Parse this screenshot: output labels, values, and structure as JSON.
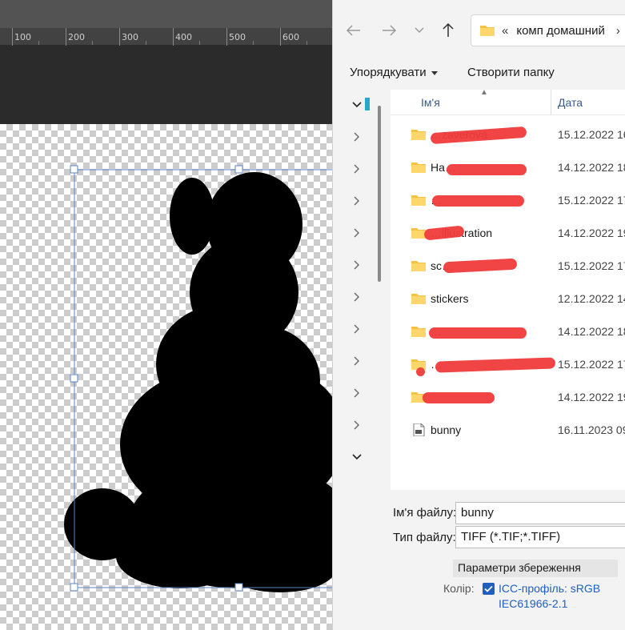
{
  "ruler": {
    "labels": [
      "100",
      "200",
      "300",
      "400",
      "500",
      "600"
    ]
  },
  "dialog": {
    "address": {
      "separator": "«",
      "path": "комп домашний",
      "arrow": "›"
    },
    "commands": {
      "organize": "Упорядкувати",
      "new_folder": "Створити папку"
    },
    "columns": {
      "name": "Ім'я",
      "date": "Дата"
    },
    "files": [
      {
        "name": "…zaverova",
        "date": "15.12.2022 16",
        "type": "folder"
      },
      {
        "name": "Ha…",
        "date": "14.12.2022 18",
        "type": "folder"
      },
      {
        "name": "…",
        "date": "15.12.2022 17",
        "type": "folder"
      },
      {
        "name": "…illustration",
        "date": "14.12.2022 19",
        "type": "folder"
      },
      {
        "name": "sc…",
        "date": "15.12.2022 17",
        "type": "folder"
      },
      {
        "name": "stickers",
        "date": "12.12.2022 14",
        "type": "folder"
      },
      {
        "name": "…",
        "date": "14.12.2022 18",
        "type": "folder"
      },
      {
        "name": "…",
        "date": "15.12.2022 17",
        "type": "folder"
      },
      {
        "name": "",
        "date": "14.12.2022 19",
        "type": "folder"
      },
      {
        "name": "bunny",
        "date": "16.11.2023 09",
        "type": "tif"
      }
    ],
    "footer": {
      "filename_label": "Ім'я файлу:",
      "filename_value": "bunny",
      "filetype_label": "Тип файлу:",
      "filetype_value": "TIFF (*.TIF;*.TIFF)",
      "save_options": "Параметри збереження",
      "color_label": "Колір:",
      "icc_line1": "ICC-профіль:  sRGB",
      "icc_line2": "IEC61966-2.1"
    }
  },
  "colors": {
    "accent": "#1f5fbf",
    "folder": "#f5c242",
    "redaction": "#f03a3a"
  }
}
